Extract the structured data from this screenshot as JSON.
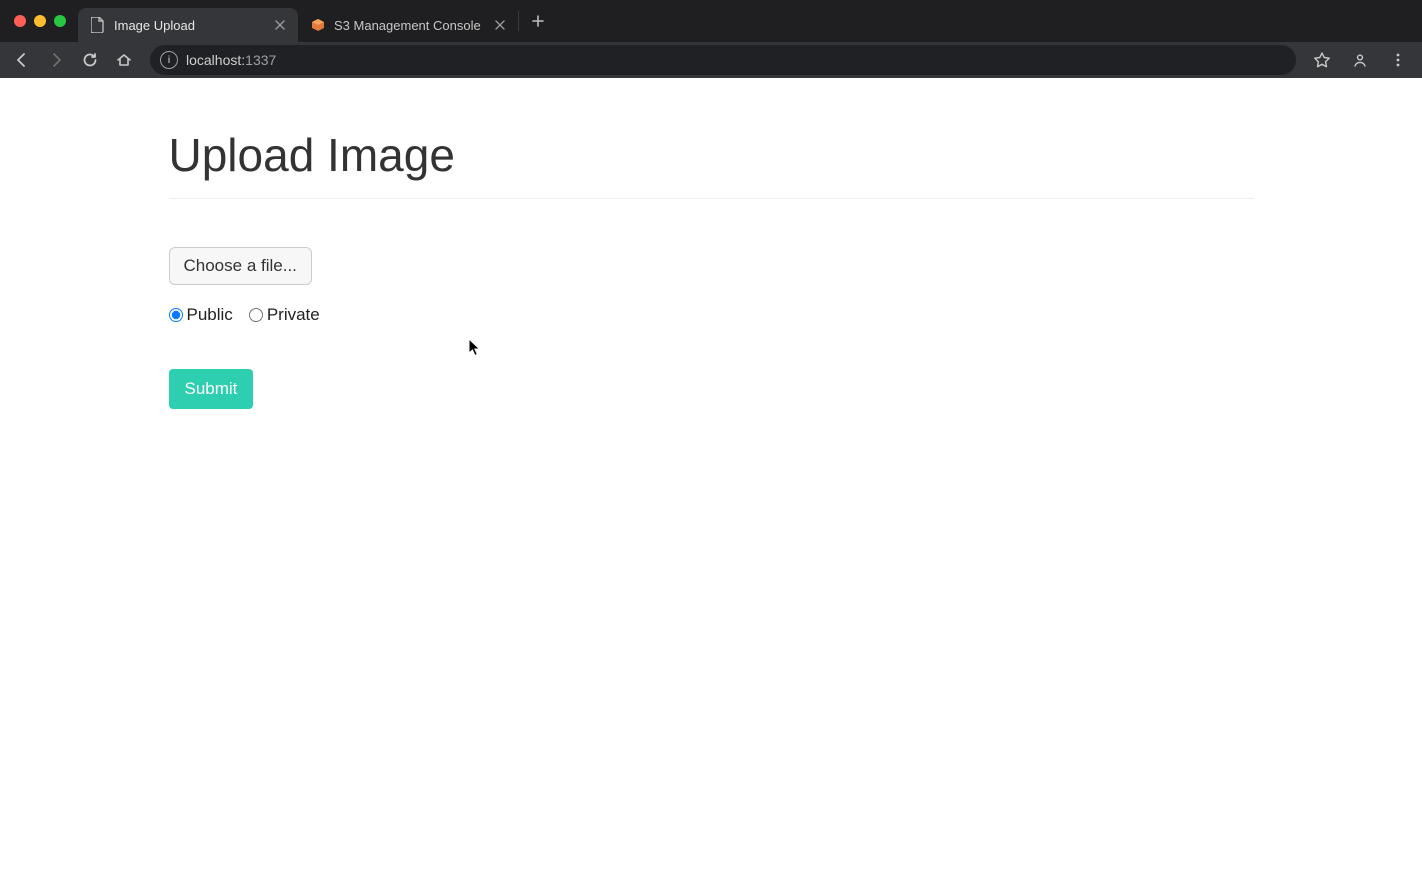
{
  "browser": {
    "tabs": [
      {
        "title": "Image Upload",
        "active": true,
        "icon": "file-icon"
      },
      {
        "title": "S3 Management Console",
        "active": false,
        "icon": "cube-icon"
      }
    ],
    "url_host": "localhost:",
    "url_port": "1337"
  },
  "page": {
    "title": "Upload Image",
    "file_button_label": "Choose a file...",
    "visibility_options": [
      {
        "label": "Public",
        "value": "public",
        "checked": true
      },
      {
        "label": "Private",
        "value": "private",
        "checked": false
      }
    ],
    "submit_label": "Submit"
  },
  "colors": {
    "accent": "#2ecfb0",
    "chrome_tab_bg": "#35363a",
    "url_dim": "#9aa0a6"
  }
}
